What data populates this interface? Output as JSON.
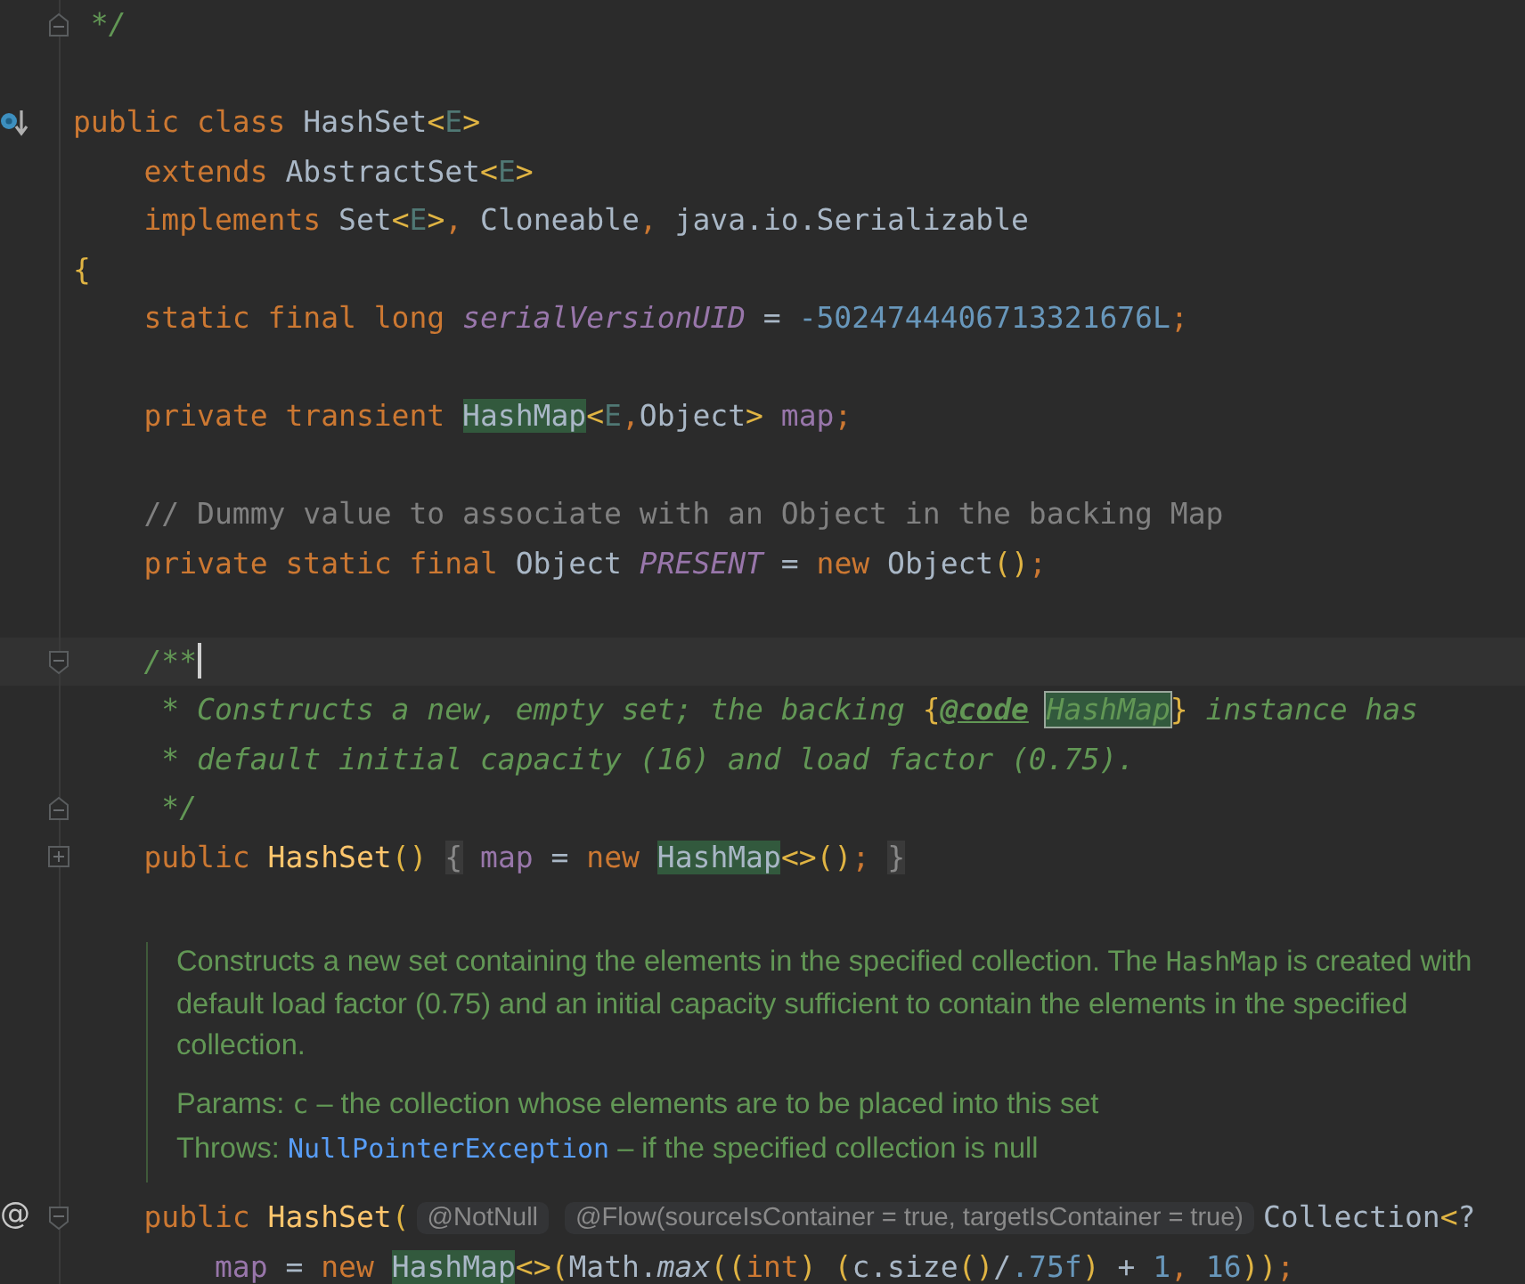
{
  "editor": {
    "rows": [
      {
        "kind": "code",
        "fold_end": true,
        "tokens": [
          {
            "kind": "doc",
            "text": " */"
          }
        ]
      },
      {
        "kind": "blank"
      },
      {
        "kind": "code",
        "overrides": true,
        "tokens": [
          {
            "kind": "keyword",
            "text": "public class "
          },
          {
            "kind": "type",
            "text": "HashSet"
          },
          {
            "kind": "bracket",
            "text": "<"
          },
          {
            "kind": "generic",
            "text": "E"
          },
          {
            "kind": "bracket",
            "text": ">"
          }
        ]
      },
      {
        "kind": "code",
        "tokens": [
          {
            "kind": "keyword",
            "text": "    extends "
          },
          {
            "kind": "type",
            "text": "AbstractSet"
          },
          {
            "kind": "bracket",
            "text": "<"
          },
          {
            "kind": "generic",
            "text": "E"
          },
          {
            "kind": "bracket",
            "text": ">"
          }
        ]
      },
      {
        "kind": "code",
        "tokens": [
          {
            "kind": "keyword",
            "text": "    implements "
          },
          {
            "kind": "type",
            "text": "Set"
          },
          {
            "kind": "bracket",
            "text": "<"
          },
          {
            "kind": "generic",
            "text": "E"
          },
          {
            "kind": "bracket",
            "text": ">"
          },
          {
            "kind": "operator",
            "text": ", "
          },
          {
            "kind": "type",
            "text": "Cloneable"
          },
          {
            "kind": "operator",
            "text": ", "
          },
          {
            "kind": "plain",
            "text": "java.io.Serializable"
          }
        ]
      },
      {
        "kind": "code",
        "tokens": [
          {
            "kind": "bracket",
            "text": "{"
          }
        ]
      },
      {
        "kind": "code",
        "tokens": [
          {
            "kind": "keyword",
            "text": "    static final long "
          },
          {
            "kind": "constant",
            "text": "serialVersionUID"
          },
          {
            "kind": "plain",
            "text": " = "
          },
          {
            "kind": "number",
            "text": "-5024744406713321676L"
          },
          {
            "kind": "operator",
            "text": ";"
          }
        ]
      },
      {
        "kind": "blank"
      },
      {
        "kind": "code",
        "tokens": [
          {
            "kind": "keyword",
            "text": "    private transient "
          },
          {
            "kind": "type",
            "text": "HashMap",
            "highlighted": true
          },
          {
            "kind": "bracket",
            "text": "<"
          },
          {
            "kind": "generic",
            "text": "E"
          },
          {
            "kind": "operator",
            "text": ","
          },
          {
            "kind": "type",
            "text": "Object"
          },
          {
            "kind": "bracket",
            "text": ">"
          },
          {
            "kind": "field",
            "text": " map"
          },
          {
            "kind": "operator",
            "text": ";"
          }
        ]
      },
      {
        "kind": "blank"
      },
      {
        "kind": "code",
        "tokens": [
          {
            "kind": "comment",
            "text": "    // Dummy value to associate with an Object in the backing Map"
          }
        ]
      },
      {
        "kind": "code",
        "tokens": [
          {
            "kind": "keyword",
            "text": "    private static final "
          },
          {
            "kind": "type",
            "text": "Object"
          },
          {
            "kind": "constant",
            "text": " PRESENT"
          },
          {
            "kind": "plain",
            "text": " = "
          },
          {
            "kind": "keyword",
            "text": "new "
          },
          {
            "kind": "type",
            "text": "Object"
          },
          {
            "kind": "bracket",
            "text": "()"
          },
          {
            "kind": "operator",
            "text": ";"
          }
        ]
      },
      {
        "kind": "blank"
      },
      {
        "kind": "code",
        "current": true,
        "fold_start": true,
        "tokens": [
          {
            "kind": "doc",
            "text": "    /**"
          }
        ]
      },
      {
        "kind": "code",
        "tokens": [
          {
            "kind": "doc",
            "text": "     * Constructs a new, empty set; the backing "
          },
          {
            "kind": "bracket",
            "text": "{"
          },
          {
            "kind": "tag",
            "text": "@code"
          },
          {
            "kind": "doc",
            "text": "HashMap",
            "highlighted": true,
            "outlined": true
          },
          {
            "kind": "bracket",
            "text": "}"
          },
          {
            "kind": "doc",
            "text": " instance has"
          }
        ]
      },
      {
        "kind": "code",
        "tokens": [
          {
            "kind": "doc",
            "text": "     * default initial capacity (16) and load factor (0.75)."
          }
        ]
      },
      {
        "kind": "code",
        "fold_end": true,
        "tokens": [
          {
            "kind": "doc",
            "text": "     */"
          }
        ]
      },
      {
        "kind": "code",
        "folded": true,
        "tokens": [
          {
            "kind": "keyword",
            "text": "    public "
          },
          {
            "kind": "method",
            "text": "HashSet"
          },
          {
            "kind": "bracket",
            "text": "() "
          },
          {
            "kind": "plain",
            "text": "{",
            "folded": true
          },
          {
            "kind": "field",
            "text": " map"
          },
          {
            "kind": "plain",
            "text": " = "
          },
          {
            "kind": "keyword",
            "text": "new "
          },
          {
            "kind": "type",
            "text": "HashMap",
            "highlighted": true
          },
          {
            "kind": "bracket",
            "text": "<>()"
          },
          {
            "kind": "operator",
            "text": "; "
          },
          {
            "kind": "plain",
            "text": "}",
            "folded": true
          }
        ]
      },
      {
        "kind": "doc",
        "lines": [
          [
            {
              "text": "Constructs a new set containing the elements in the specified collection. The "
            },
            {
              "text": "HashMap",
              "code": true
            },
            {
              "text": " is created with"
            }
          ],
          [
            {
              "text": "default load factor (0.75) and an initial capacity sufficient to contain the elements in the specified"
            }
          ],
          [
            {
              "text": "collection."
            }
          ],
          [
            {
              "text": "Params: "
            },
            {
              "text": "c",
              "code": true
            },
            {
              "text": " – the collection whose elements are to be placed into this set"
            }
          ],
          [
            {
              "text": "Throws: "
            },
            {
              "text": "NullPointerException",
              "link": true
            },
            {
              "text": " – if the specified collection is null"
            }
          ]
        ]
      },
      {
        "kind": "code",
        "gutter_text": "@",
        "fold_start": true,
        "tokens": [
          {
            "kind": "keyword",
            "text": "    public "
          },
          {
            "kind": "method",
            "text": "HashSet"
          },
          {
            "kind": "bracket",
            "text": "("
          },
          {
            "kind": "hint",
            "text": "@NotNull"
          },
          {
            "kind": "hint",
            "text": "@Flow(sourceIsContainer = true, targetIsContainer = true)"
          },
          {
            "kind": "type",
            "text": "Collection"
          },
          {
            "kind": "bracket",
            "text": "<"
          },
          {
            "kind": "plain",
            "text": "?"
          }
        ]
      },
      {
        "kind": "code",
        "tokens": [
          {
            "kind": "field",
            "text": "        map"
          },
          {
            "kind": "plain",
            "text": " = "
          },
          {
            "kind": "keyword",
            "text": "new "
          },
          {
            "kind": "type",
            "text": "HashMap",
            "highlighted": true
          },
          {
            "kind": "bracket",
            "text": "<>("
          },
          {
            "kind": "plain",
            "text": "Math."
          },
          {
            "kind": "static-method",
            "text": "max"
          },
          {
            "kind": "bracket",
            "text": "(("
          },
          {
            "kind": "keyword",
            "text": "int"
          },
          {
            "kind": "bracket",
            "text": ") "
          },
          {
            "kind": "bracket",
            "text": "("
          },
          {
            "kind": "plain",
            "text": "c.size"
          },
          {
            "kind": "bracket",
            "text": "()"
          },
          {
            "kind": "plain",
            "text": "/"
          },
          {
            "kind": "number",
            "text": ".75f"
          },
          {
            "kind": "bracket",
            "text": ")"
          },
          {
            "kind": "plain",
            "text": " + "
          },
          {
            "kind": "number",
            "text": "1"
          },
          {
            "kind": "operator",
            "text": ", "
          },
          {
            "kind": "number",
            "text": "16"
          },
          {
            "kind": "bracket",
            "text": "))"
          },
          {
            "kind": "operator",
            "text": ";"
          }
        ]
      }
    ]
  }
}
